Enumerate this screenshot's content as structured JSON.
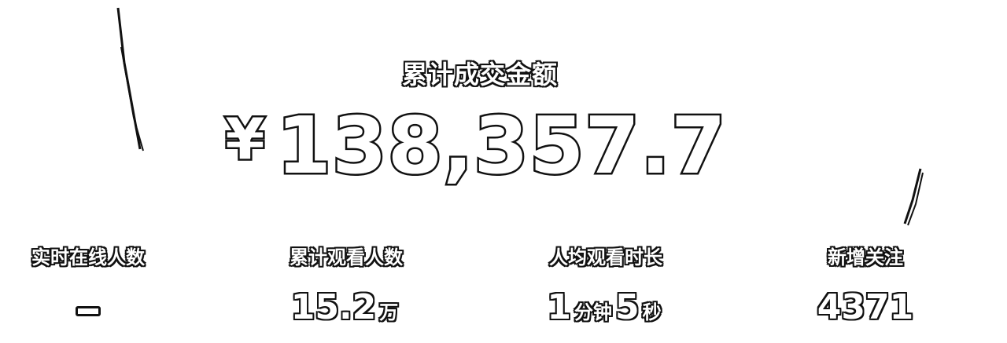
{
  "summary": {
    "title": "累计成交金额",
    "currency_symbol": "¥",
    "amount": "138,357.7"
  },
  "stats": [
    {
      "label": "实时在线人数",
      "value": "—"
    },
    {
      "label": "累计观看人数",
      "value": "15.2",
      "unit": "万"
    },
    {
      "label": "人均观看时长",
      "minutes": "1",
      "minutes_unit": "分钟",
      "seconds": "5",
      "seconds_unit": "秒"
    },
    {
      "label": "新增关注",
      "value": "4371"
    }
  ],
  "colors": {
    "background": "#ffffff",
    "outline": "#111111",
    "fill": "#ffffff"
  }
}
